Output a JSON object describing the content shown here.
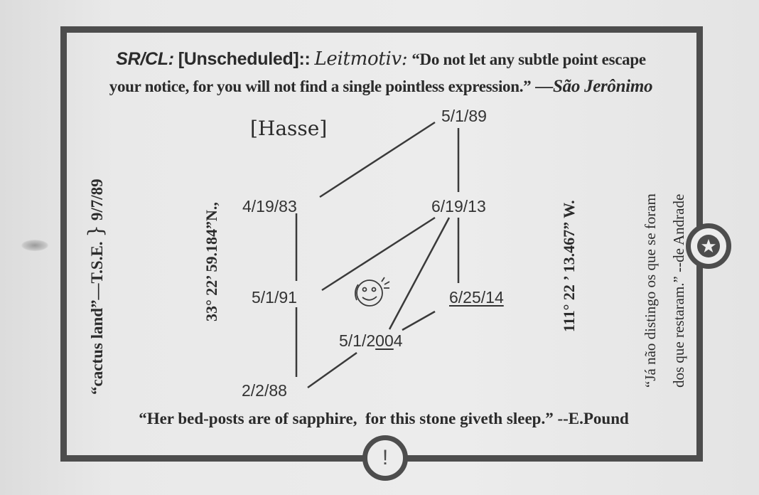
{
  "header": {
    "tag": "SR/CL:",
    "bracket": "[Unscheduled]::",
    "leitmotiv": "Leitmotiv:",
    "quote_line1": "“Do not let any subtle point escape",
    "quote_line2": "your notice, for you will not find a single pointless expression.”",
    "attribution": "—São Jerônimo"
  },
  "left_margin": {
    "cactus_quote": "“cactus land”—T.S.E.",
    "brace": "}",
    "date": "9/7/89"
  },
  "coordinates": {
    "latitude": "33° 22’ 59.184”N.,",
    "longitude": "111° 22 ’ 13.467” W."
  },
  "portuguese": {
    "line1": "“Já não distingo os que se foram",
    "line2": "dos que restaram.” --de Andrade"
  },
  "diagram": {
    "title": "[Hasse]",
    "nodes": {
      "n1": "5/1/89",
      "n2": "4/19/83",
      "n3": "6/19/13",
      "n4": "5/1/91",
      "n5": "6/25/14",
      "n6a": "5/1/2",
      "n6b": "00",
      "n6c": "4",
      "n7": "2/2/88"
    }
  },
  "footer": {
    "quote": "“Her bed-posts are of sapphire,  for this stone giveth sleep.” --E.Pound"
  },
  "icons": {
    "star_badge": "star-icon",
    "exclamation_badge": "!",
    "face": "face-doodle-icon"
  },
  "colors": {
    "frame": "#4d4d4d",
    "paper": "#e6e6e6",
    "ink": "#2b2b2b"
  }
}
